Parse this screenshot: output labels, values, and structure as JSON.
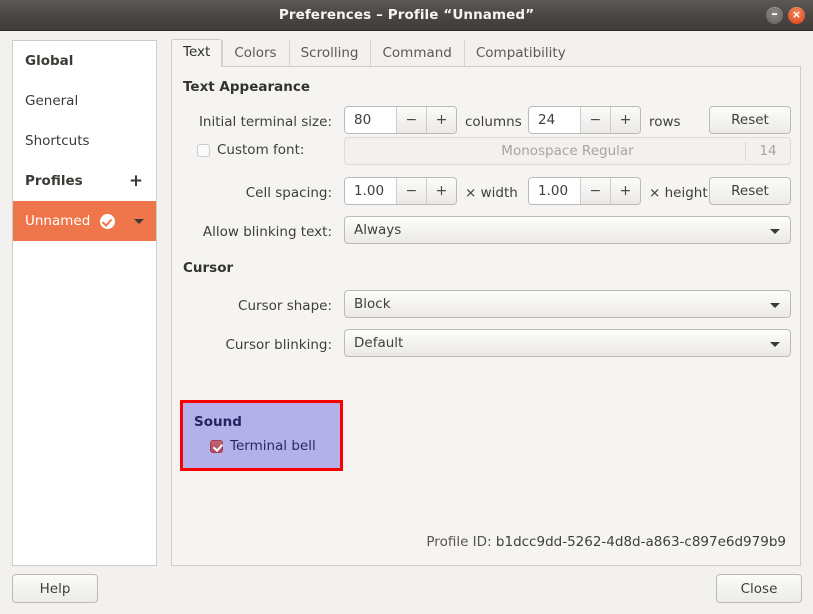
{
  "window": {
    "title": "Preferences – Profile “Unnamed”",
    "minimize_glyph": "–",
    "close_glyph": "×"
  },
  "sidebar": {
    "items": [
      {
        "label": "Global",
        "type": "header"
      },
      {
        "label": "General",
        "type": "item"
      },
      {
        "label": "Shortcuts",
        "type": "item"
      },
      {
        "label": "Profiles",
        "type": "header",
        "action": "+"
      },
      {
        "label": "Unnamed",
        "type": "profile",
        "selected": true
      }
    ],
    "add_profile_label": "+"
  },
  "tabs": [
    {
      "label": "Text",
      "active": true
    },
    {
      "label": "Colors",
      "active": false
    },
    {
      "label": "Scrolling",
      "active": false
    },
    {
      "label": "Command",
      "active": false
    },
    {
      "label": "Compatibility",
      "active": false
    }
  ],
  "text_appearance": {
    "section_title": "Text Appearance",
    "terminal_size_label": "Initial terminal size:",
    "columns_value": "80",
    "columns_unit": "columns",
    "rows_value": "24",
    "rows_unit": "rows",
    "reset_label": "Reset",
    "minus_glyph": "−",
    "plus_glyph": "+",
    "custom_font_label": "Custom font:",
    "custom_font_checked": false,
    "font_name": "Monospace Regular",
    "font_size": "14",
    "cell_spacing_label": "Cell spacing:",
    "cell_width_value": "1.00",
    "cell_width_unit": "× width",
    "cell_height_value": "1.00",
    "cell_height_unit": "× height",
    "cell_reset_label": "Reset",
    "blinking_label": "Allow blinking text:",
    "blinking_value": "Always"
  },
  "cursor": {
    "section_title": "Cursor",
    "shape_label": "Cursor shape:",
    "shape_value": "Block",
    "blinking_label": "Cursor blinking:",
    "blinking_value": "Default"
  },
  "sound": {
    "section_title": "Sound",
    "terminal_bell_label": "Terminal bell",
    "terminal_bell_checked": true,
    "highlight_color": "#fb0000",
    "highlight_fill": "#b3b0ea"
  },
  "footer": {
    "profile_id_label": "Profile ID:",
    "profile_id_value": "b1dcc9dd-5262-4d8d-a863-c897e6d979b9",
    "help_label": "Help",
    "close_label": "Close"
  },
  "colors": {
    "accent": "#ef764b",
    "titlebar": "#4a4744"
  }
}
